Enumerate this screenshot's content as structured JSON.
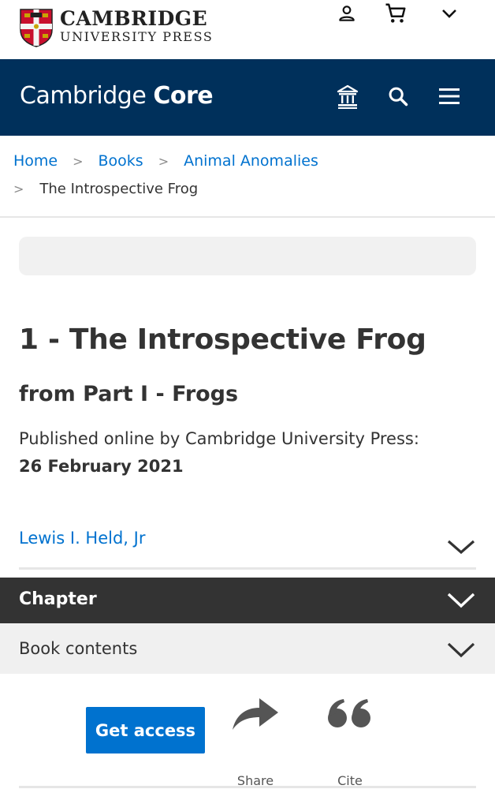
{
  "header": {
    "publisher_line1": "CAMBRIDGE",
    "publisher_line2": "UNIVERSITY PRESS",
    "icons": [
      "user-icon",
      "cart-icon",
      "chevron-down-icon"
    ]
  },
  "core_bar": {
    "brand_regular": "Cambridge",
    "brand_bold": "Core",
    "icons": [
      "institution-icon",
      "search-icon",
      "menu-icon"
    ],
    "background": "#00305b"
  },
  "breadcrumb": {
    "items": [
      {
        "label": "Home"
      },
      {
        "label": "Books"
      },
      {
        "label": "Animal Anomalies"
      }
    ],
    "current": "The Introspective Frog",
    "separator": ">"
  },
  "main": {
    "chapter_title": "1 - The Introspective Frog",
    "part_title": "from Part I - Frogs",
    "published_text": "Published online by Cambridge University Press:",
    "published_date": "26 February 2021",
    "author": "Lewis I. Held, Jr"
  },
  "sections": {
    "chapter_label": "Chapter",
    "contents_label": "Book contents"
  },
  "actions": {
    "get_access_label": "Get access",
    "share_label": "Share",
    "cite_label": "Cite"
  },
  "colors": {
    "link": "#0072cf",
    "dark_bar": "#333333",
    "light_bar": "#f0f0f0"
  }
}
